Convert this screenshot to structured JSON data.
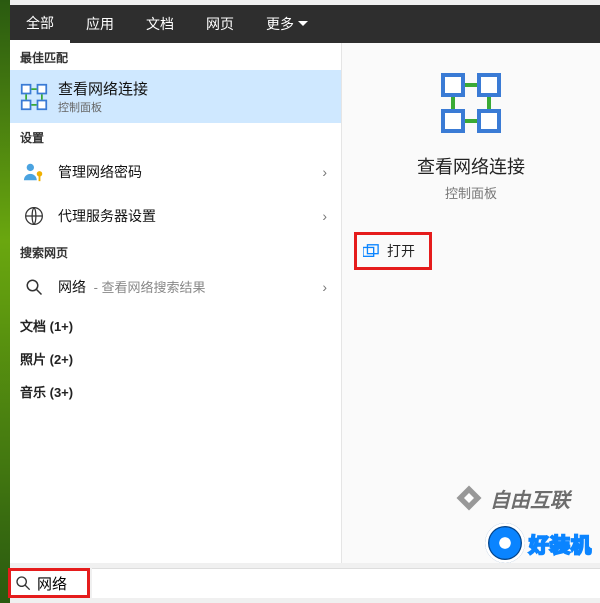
{
  "tabs": {
    "all": "全部",
    "apps": "应用",
    "docs": "文档",
    "web": "网页",
    "more": "更多"
  },
  "sections": {
    "best_match": "最佳匹配",
    "settings": "设置",
    "search_web": "搜索网页"
  },
  "best": {
    "title": "查看网络连接",
    "sub": "控制面板"
  },
  "settings_items": {
    "manage_pw": "管理网络密码",
    "proxy": "代理服务器设置"
  },
  "web": {
    "term": "网络",
    "suffix": " - 查看网络搜索结果"
  },
  "categories": {
    "docs": "文档 (1+)",
    "photos": "照片 (2+)",
    "music": "音乐 (3+)"
  },
  "preview": {
    "title": "查看网络连接",
    "sub": "控制面板",
    "open": "打开"
  },
  "search": {
    "value": "网络",
    "placeholder": ""
  },
  "watermarks": {
    "wm1": "自由互联",
    "wm2": "好装机"
  }
}
